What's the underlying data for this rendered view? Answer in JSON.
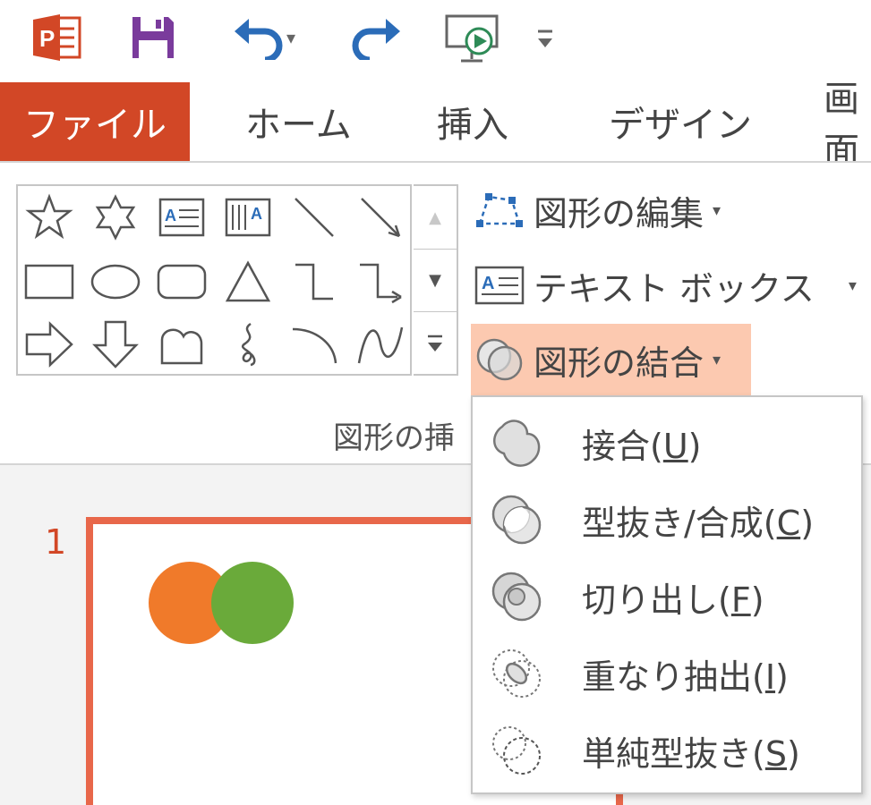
{
  "app": {
    "brand_color": "#d24726"
  },
  "quick_access": [
    {
      "name": "powerpoint-logo-icon"
    },
    {
      "name": "save-icon"
    },
    {
      "name": "undo-icon"
    },
    {
      "name": "redo-icon"
    },
    {
      "name": "slideshow-from-start-icon"
    },
    {
      "name": "customize-toolbar-icon"
    }
  ],
  "tabs": {
    "file": "ファイル",
    "home": "ホーム",
    "insert": "挿入",
    "design": "デザイン",
    "transitions_partial": "画面"
  },
  "ribbon": {
    "edit_shape": "図形の編集",
    "text_box": "テキスト ボックス",
    "merge_shapes": "図形の結合",
    "group_label_partial": "図形の挿"
  },
  "merge_menu": {
    "items": [
      {
        "label": "接合(",
        "key": "U",
        "tail": ")",
        "icon": "union-icon"
      },
      {
        "label": "型抜き/合成(",
        "key": "C",
        "tail": ")",
        "icon": "combine-icon"
      },
      {
        "label": "切り出し(",
        "key": "F",
        "tail": ")",
        "icon": "fragment-icon"
      },
      {
        "label": "重なり抽出(",
        "key": "I",
        "tail": ")",
        "icon": "intersect-icon"
      },
      {
        "label": "単純型抜き(",
        "key": "S",
        "tail": ")",
        "icon": "subtract-icon"
      }
    ]
  },
  "slide": {
    "number": "1",
    "circle_colors": {
      "orange": "#f07a2a",
      "green": "#6aaa3a"
    }
  }
}
